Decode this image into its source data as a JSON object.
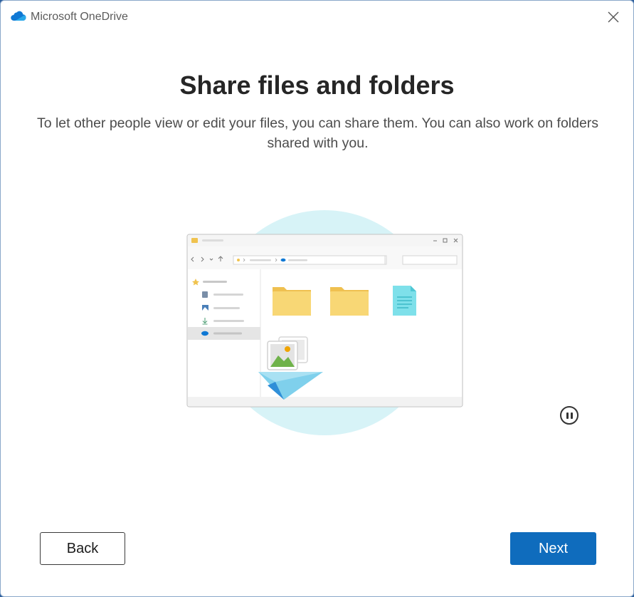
{
  "window": {
    "app_title": "Microsoft OneDrive",
    "close_icon": "close-icon"
  },
  "main": {
    "heading": "Share files and folders",
    "description": "To let other people view or edit your files, you can share them. You can also work on folders shared with you."
  },
  "illustration": {
    "description_icon": "file-explorer-share-illustration"
  },
  "animation": {
    "pause_icon": "pause-icon"
  },
  "footer": {
    "back_label": "Back",
    "next_label": "Next"
  },
  "colors": {
    "accent": "#0f6cbd",
    "circle_bg": "#d7f3f7",
    "folder": "#f8d775",
    "folder_dark": "#efc050"
  }
}
